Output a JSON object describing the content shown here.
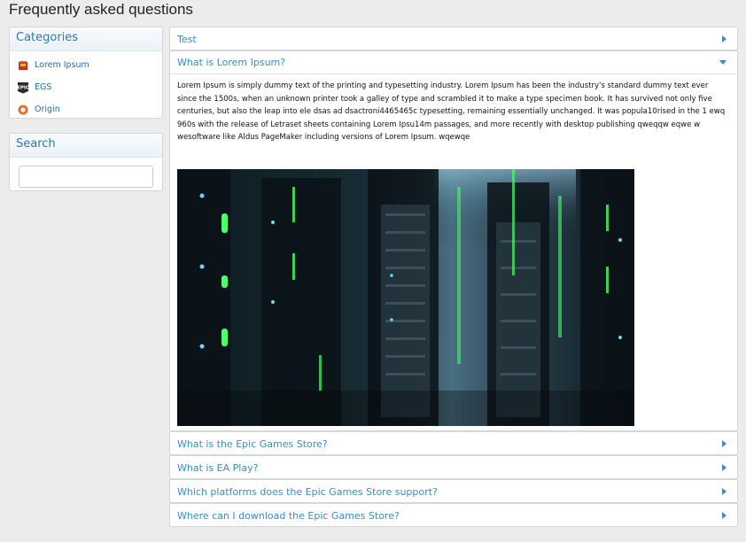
{
  "page": {
    "title": "Frequently asked questions"
  },
  "categories": {
    "heading": "Categories",
    "items": [
      {
        "label": "Lorem Ipsum",
        "icon": "lorem-ipsum-category-icon"
      },
      {
        "label": "EGS",
        "icon": "epic-games-icon"
      },
      {
        "label": "Origin",
        "icon": "origin-icon"
      }
    ]
  },
  "search": {
    "heading": "Search",
    "value": ""
  },
  "faq": {
    "items": [
      {
        "question": "Test"
      },
      {
        "question": "What is Lorem Ipsum?",
        "answer": "Lorem Ipsum is simply dummy text of the printing and typesetting industry. Lorem Ipsum has been the industry's standard dummy text ever since the 1500s, when an unknown printer took a galley of type and scrambled it to make a type specimen book. It has survived not only five centuries, but also the leap into ele dsas ad dsactroni4465465c typesetting, remaining essentially unchanged. It was popula10rised in the 1 ewq 960s with the release of Letraset sheets containing Lorem Ipsu14m passages, and more recently with desktop publishing qweqqw eqwe w wesoftware like Aldus PageMaker including versions of Lorem Ipsum. wqewqe"
      },
      {
        "question": "What is the Epic Games Store?"
      },
      {
        "question": "What is EA Play?"
      },
      {
        "question": "Which platforms does the Epic Games Store support?"
      },
      {
        "question": "Where can I download the Epic Games Store?"
      }
    ]
  },
  "colors": {
    "link": "#3a8cc8",
    "heading": "#2a7ab8",
    "background": "#ececec"
  }
}
